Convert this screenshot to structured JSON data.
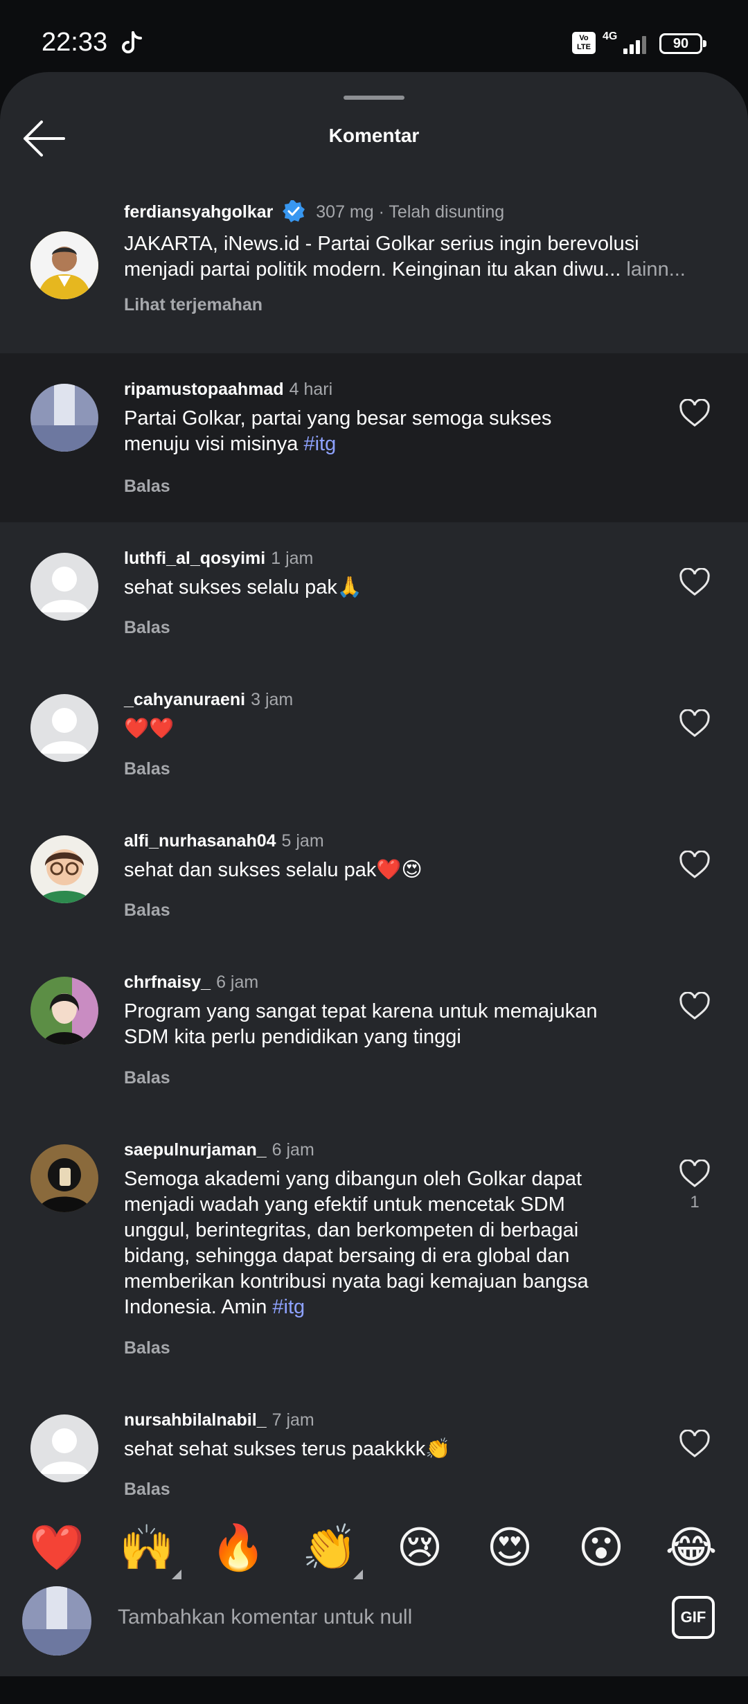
{
  "status": {
    "time": "22:33",
    "volte": "Vo LTE",
    "network": "4G",
    "battery": "90"
  },
  "header": {
    "title": "Komentar"
  },
  "caption": {
    "username": "ferdiansyahgolkar",
    "meta": "307 mg · Telah disunting",
    "text_line1": "JAKARTA, iNews.id - Partai Golkar serius ingin berevolusi",
    "text_line2": "menjadi partai politik modern. Keinginan itu akan diwu...",
    "more": "lainn...",
    "translate": "Lihat terjemahan"
  },
  "comments": [
    {
      "username": "ripamustopaahmad",
      "time": "4 hari",
      "text_line1": "Partai Golkar, partai yang besar semoga sukses",
      "text_line2": "menuju visi misinya",
      "hashtag": "#itg",
      "reply": "Balas"
    },
    {
      "username": "luthfi_al_qosyimi",
      "time": "1 jam",
      "text": "sehat sukses selalu pak🙏",
      "reply": "Balas"
    },
    {
      "username": "_cahyanuraeni",
      "time": "3 jam",
      "text": "❤️❤️",
      "reply": "Balas"
    },
    {
      "username": "alfi_nurhasanah04",
      "time": "5 jam",
      "text": "sehat dan sukses selalu pak❤️😍",
      "reply": "Balas"
    },
    {
      "username": "chrfnaisy_",
      "time": "6 jam",
      "text_line1": "Program yang sangat tepat karena untuk memajukan",
      "text_line2": "SDM kita perlu pendidikan yang tinggi",
      "reply": "Balas"
    },
    {
      "username": "saepulnurjaman_",
      "time": "6 jam",
      "lines": [
        "Semoga akademi yang dibangun oleh Golkar dapat",
        "menjadi wadah yang efektif untuk mencetak SDM",
        "unggul, berintegritas, dan berkompeten di berbagai",
        "bidang, sehingga dapat bersaing di era global dan",
        "memberikan kontribusi nyata bagi kemajuan bangsa"
      ],
      "last_line": "Indonesia. Amin",
      "hashtag": "#itg",
      "likes": "1",
      "reply": "Balas"
    },
    {
      "username": "nursahbilalnabil_",
      "time": "7 jam",
      "text": "sehat sehat sukses terus paakkkk👏",
      "reply": "Balas"
    }
  ],
  "emoji_bar": [
    "❤️",
    "🙌",
    "🔥",
    "👏",
    "😢",
    "😍",
    "😮",
    "😂"
  ],
  "composer": {
    "placeholder": "Tambahkan komentar untuk null",
    "gif": "GIF"
  },
  "colors": {
    "background": "#25272b",
    "highlight": "#1c1d20",
    "hashtag": "#8ea2ff",
    "verified": "#3897f0"
  }
}
